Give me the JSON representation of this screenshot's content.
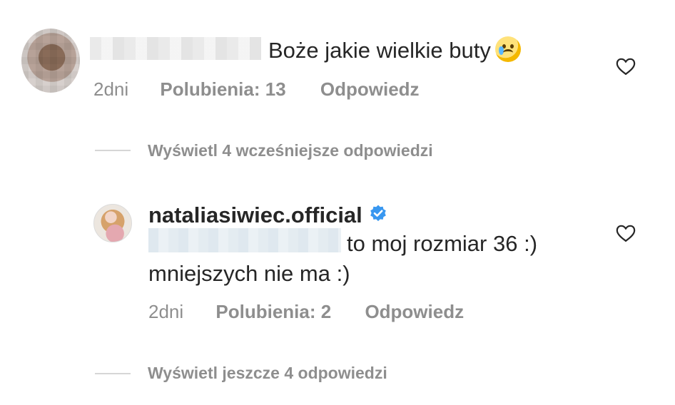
{
  "comment": {
    "text": "Boże jakie wielkie buty",
    "emoji_name": "crying-face-emoji",
    "time": "2dni",
    "likes": "Polubienia: 13",
    "reply_label": "Odpowiedz"
  },
  "replies_thread_1": {
    "view_label": "Wyświetl 4 wcześniejsze odpowiedzi"
  },
  "reply": {
    "username": "nataliasiwiec.official",
    "verified_icon": "verified-badge-icon",
    "line1": "to moj rozmiar 36 :)",
    "line2": "mniejszych nie ma :)",
    "time": "2dni",
    "likes": "Polubienia: 2",
    "reply_label": "Odpowiedz"
  },
  "replies_thread_2": {
    "view_label": "Wyświetl jeszcze 4 odpowiedzi"
  },
  "icons": {
    "like": "heart-outline-icon"
  },
  "colors": {
    "text_primary": "#262626",
    "text_secondary": "#8e8e8e",
    "verified_blue": "#3897f0",
    "divider": "#d6d6d6"
  }
}
